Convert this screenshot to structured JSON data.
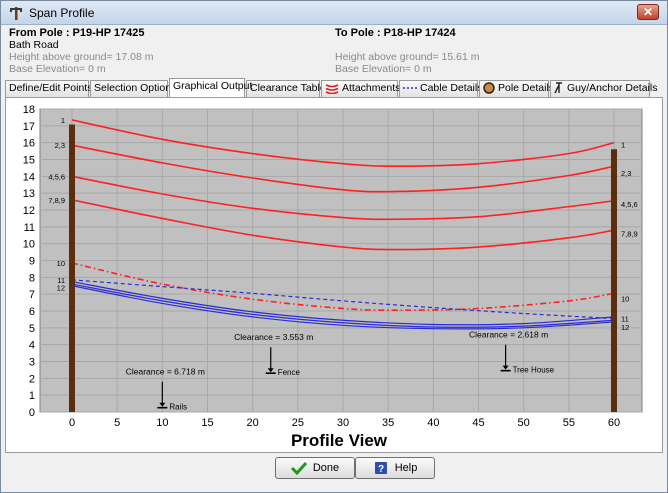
{
  "window": {
    "title": "Span Profile",
    "close_label": "✕"
  },
  "from_pole": {
    "label": "From Pole : P19-HP 17425",
    "road": "Bath Road",
    "height": "Height above ground= 17.08 m",
    "base_elevation": "Base Elevation= 0 m"
  },
  "to_pole": {
    "label": "To Pole : P18-HP 17424",
    "height": "Height above ground= 15.61 m",
    "base_elevation": "Base Elevation= 0 m"
  },
  "tabs": [
    {
      "label": "Define/Edit Points",
      "icon": ""
    },
    {
      "label": "Selection Options",
      "icon": ""
    },
    {
      "label": "Graphical Output",
      "icon": ""
    },
    {
      "label": "Clearance Table",
      "icon": ""
    },
    {
      "label": "Attachments",
      "icon": "attachments-icon"
    },
    {
      "label": "Cable Details",
      "icon": "dashed-cable-icon"
    },
    {
      "label": "Pole Details",
      "icon": "pole-circle-icon"
    },
    {
      "label": "Guy/Anchor Details",
      "icon": "guy-anchor-icon"
    }
  ],
  "active_tab": "Graphical Output",
  "buttons": {
    "done": "Done",
    "help": "Help"
  },
  "colors": {
    "red": "#ff2020",
    "blue": "#2a2ad8",
    "pole": "#5a2e0e",
    "plot_bg": "#c0c0c0"
  },
  "chart_data": {
    "type": "line",
    "title": "Profile View",
    "xlim": [
      0,
      60
    ],
    "ylim": [
      0,
      18
    ],
    "x_ticks": [
      0,
      5,
      10,
      15,
      20,
      25,
      30,
      35,
      40,
      45,
      50,
      55,
      60
    ],
    "y_ticks": [
      0,
      1,
      2,
      3,
      4,
      5,
      6,
      7,
      8,
      9,
      10,
      11,
      12,
      13,
      14,
      15,
      16,
      17,
      18
    ],
    "grid": true,
    "poles": [
      {
        "x": 0,
        "height": 17.08
      },
      {
        "x": 60,
        "height": 15.61
      }
    ],
    "series": [
      {
        "color": "red",
        "style": "solid",
        "x": [
          0,
          10,
          20,
          30,
          36,
          45,
          55,
          60
        ],
        "y": [
          17.35,
          16.2,
          15.35,
          14.75,
          14.6,
          14.75,
          15.35,
          16.0
        ]
      },
      {
        "color": "red",
        "style": "solid",
        "x": [
          0,
          10,
          20,
          30,
          36,
          45,
          55,
          60
        ],
        "y": [
          15.85,
          14.8,
          13.9,
          13.2,
          13.1,
          13.35,
          14.05,
          14.6
        ]
      },
      {
        "color": "red",
        "style": "solid",
        "x": [
          0,
          10,
          20,
          30,
          36,
          45,
          55,
          60
        ],
        "y": [
          14.0,
          12.95,
          12.1,
          11.55,
          11.45,
          11.6,
          12.2,
          12.55
        ]
      },
      {
        "color": "red",
        "style": "solid",
        "x": [
          0,
          10,
          20,
          30,
          36,
          45,
          55,
          60
        ],
        "y": [
          12.6,
          11.5,
          10.5,
          9.8,
          9.65,
          9.8,
          10.35,
          10.8
        ]
      },
      {
        "color": "red",
        "style": "dashdot",
        "x": [
          0,
          10,
          20,
          30,
          36,
          45,
          55,
          60
        ],
        "y": [
          8.85,
          7.6,
          6.7,
          6.15,
          6.05,
          6.15,
          6.6,
          7.05
        ]
      },
      {
        "color": "blue",
        "style": "dashed",
        "x": [
          0,
          10,
          20,
          30,
          40,
          50,
          60
        ],
        "y": [
          7.85,
          7.45,
          7.05,
          6.6,
          6.2,
          5.85,
          5.55
        ]
      },
      {
        "color": "blue",
        "style": "solid",
        "x": [
          0,
          10,
          20,
          30,
          40,
          50,
          60
        ],
        "y": [
          7.75,
          6.75,
          5.95,
          5.45,
          5.2,
          5.25,
          5.65
        ]
      },
      {
        "color": "blue",
        "style": "solid",
        "x": [
          0,
          10,
          20,
          30,
          40,
          50,
          60
        ],
        "y": [
          7.6,
          6.6,
          5.8,
          5.3,
          5.05,
          5.1,
          5.45
        ]
      },
      {
        "color": "blue",
        "style": "solid",
        "x": [
          0,
          10,
          20,
          30,
          40,
          50,
          60
        ],
        "y": [
          7.5,
          6.45,
          5.65,
          5.15,
          4.95,
          5.0,
          5.35
        ]
      }
    ],
    "left_labels": [
      {
        "text": "1",
        "y": 17.35
      },
      {
        "text": "2,3",
        "y": 15.85
      },
      {
        "text": "4,5,6",
        "y": 14.0
      },
      {
        "text": "7,8,9",
        "y": 12.6
      },
      {
        "text": "10",
        "y": 8.85
      },
      {
        "text": "11",
        "y": 7.85
      },
      {
        "text": "12",
        "y": 7.4
      }
    ],
    "right_labels": [
      {
        "text": "1",
        "y": 15.9
      },
      {
        "text": "2,3",
        "y": 14.2
      },
      {
        "text": "4,5,6",
        "y": 12.35
      },
      {
        "text": "7,8,9",
        "y": 10.6
      },
      {
        "text": "10",
        "y": 6.75
      },
      {
        "text": "11",
        "y": 5.55
      },
      {
        "text": "12",
        "y": 5.05
      }
    ],
    "annotations": [
      {
        "text": "Clearance = 6.718 m",
        "x": 10,
        "arrow_top": 1.8,
        "object": "Rails"
      },
      {
        "text": "Clearance = 3.553 m",
        "x": 22,
        "arrow_top": 3.85,
        "object": "Fence"
      },
      {
        "text": "Clearance = 2.618 m",
        "x": 48,
        "arrow_top": 4.0,
        "object": "Tree House"
      }
    ]
  }
}
